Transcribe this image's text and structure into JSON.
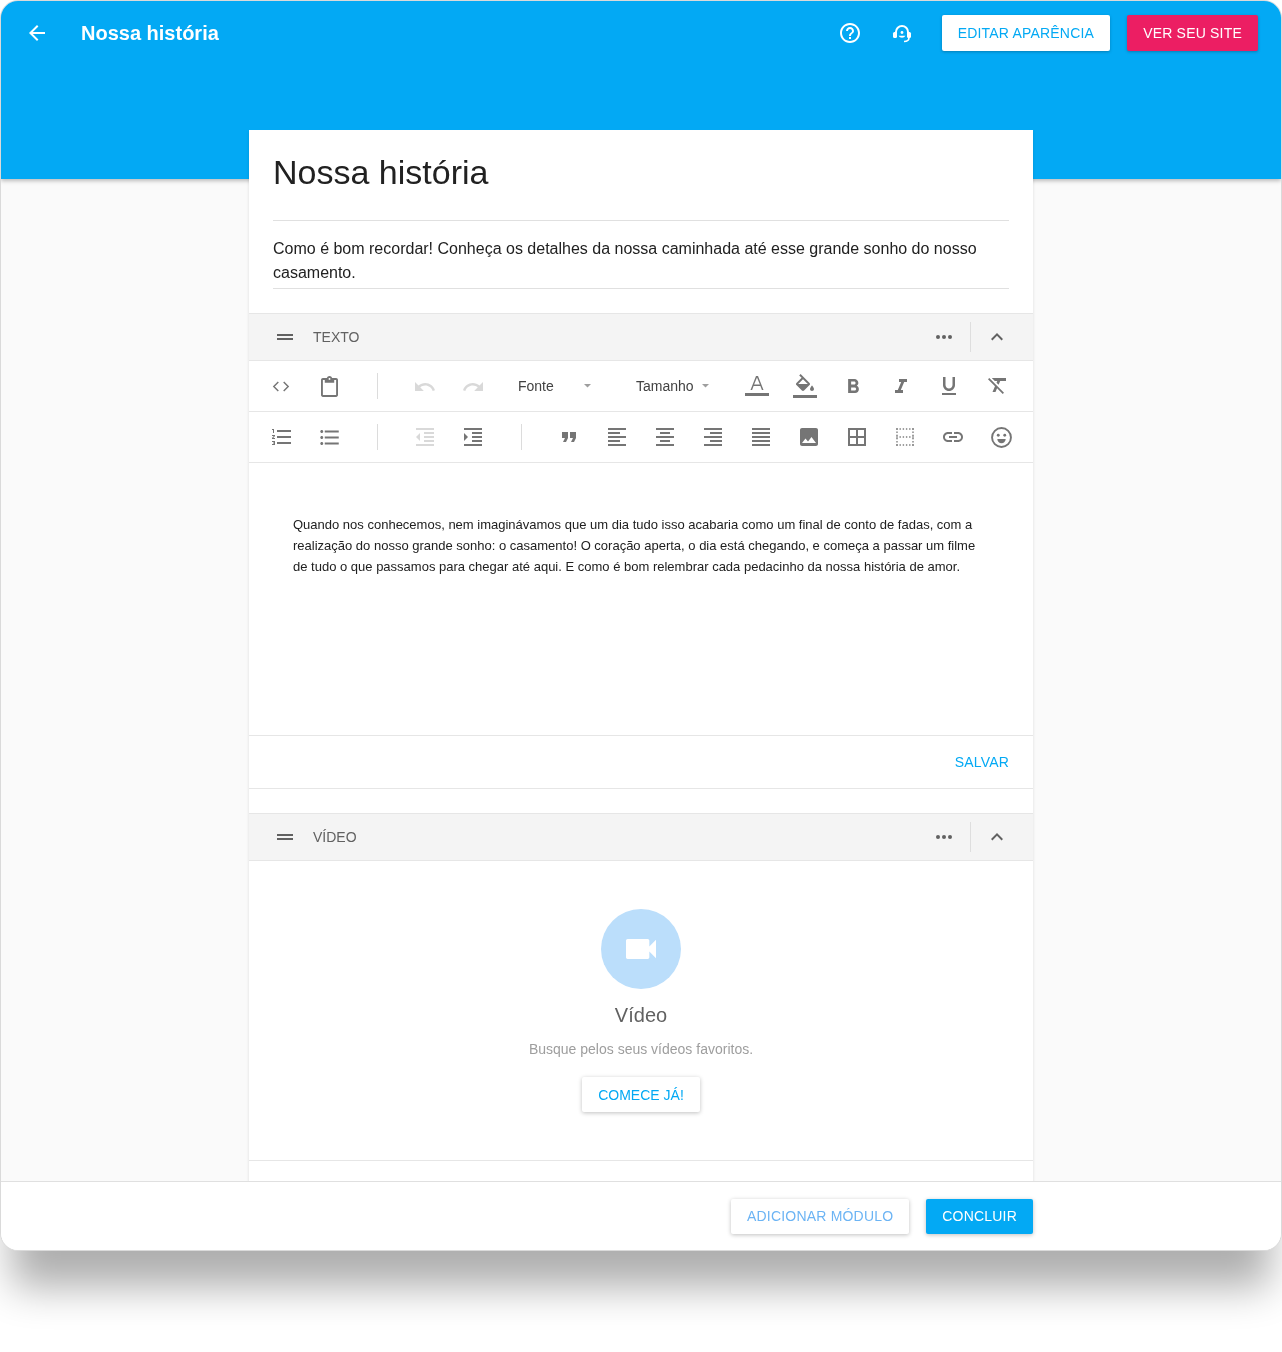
{
  "app_bar": {
    "title": "Nossa história",
    "buttons": [
      {
        "label": "EDITAR APARÊNCIA",
        "kind": "outlined"
      },
      {
        "label": "VER SEU SITE",
        "kind": "accent"
      }
    ]
  },
  "page": {
    "title": "Nossa história",
    "description": "Como é bom recordar! Conheça os detalhes da nossa caminhada até esse grande sonho do nosso casamento."
  },
  "modules": [
    {
      "kind": "text",
      "label": "TEXTO",
      "expanded": true,
      "toolbar": [
        {
          "groups": [
            {
              "tools": [
                {
                  "kind": "code",
                  "disabled": false
                },
                {
                  "kind": "paste",
                  "disabled": false
                }
              ]
            },
            {
              "tools": [
                {
                  "kind": "undo",
                  "disabled": true
                },
                {
                  "kind": "redo",
                  "disabled": true
                },
                {
                  "kind": "dropdown",
                  "label": "Fonte",
                  "disabled": false
                },
                {
                  "kind": "dropdown",
                  "label": "Tamanho",
                  "disabled": false
                },
                {
                  "kind": "textcolor",
                  "disabled": false
                },
                {
                  "kind": "fillcolor",
                  "disabled": false
                },
                {
                  "kind": "bold",
                  "disabled": false
                },
                {
                  "kind": "italic",
                  "disabled": false
                },
                {
                  "kind": "underline",
                  "disabled": false
                },
                {
                  "kind": "clearformat",
                  "disabled": false
                }
              ]
            }
          ]
        },
        {
          "groups": [
            {
              "tools": [
                {
                  "kind": "numbered",
                  "disabled": false
                },
                {
                  "kind": "bulleted",
                  "disabled": false
                }
              ]
            },
            {
              "tools": [
                {
                  "kind": "outdent",
                  "disabled": true
                },
                {
                  "kind": "indent",
                  "disabled": false
                }
              ]
            },
            {
              "tools": [
                {
                  "kind": "quote",
                  "disabled": false
                },
                {
                  "kind": "alignleft",
                  "disabled": false
                },
                {
                  "kind": "aligncenter",
                  "disabled": false
                },
                {
                  "kind": "alignright",
                  "disabled": false
                },
                {
                  "kind": "justify",
                  "disabled": false
                },
                {
                  "kind": "image",
                  "disabled": false
                },
                {
                  "kind": "table",
                  "disabled": false
                },
                {
                  "kind": "grid",
                  "disabled": false
                },
                {
                  "kind": "link",
                  "disabled": false
                },
                {
                  "kind": "emoji",
                  "disabled": false
                }
              ]
            }
          ]
        }
      ],
      "body": "Quando nos conhecemos, nem imaginávamos que um dia tudo isso acabaria como um final de conto de fadas, com a realização do nosso grande sonho: o casamento! O coração aperta, o dia está chegando, e começa a passar um filme de tudo o que passamos para chegar até aqui. E como é bom relembrar cada pedacinho da nossa história de amor.",
      "save_label": "SALVAR"
    },
    {
      "kind": "video",
      "label": "VÍDEO",
      "expanded": true,
      "title": "Vídeo",
      "hint": "Busque pelos seus vídeos favoritos.",
      "button": "COMECE JÁ!"
    }
  ],
  "footer": {
    "buttons": [
      {
        "label": "ADICIONAR MÓDULO",
        "kind": "secondary"
      },
      {
        "label": "CONCLUIR",
        "kind": "primary"
      }
    ]
  }
}
